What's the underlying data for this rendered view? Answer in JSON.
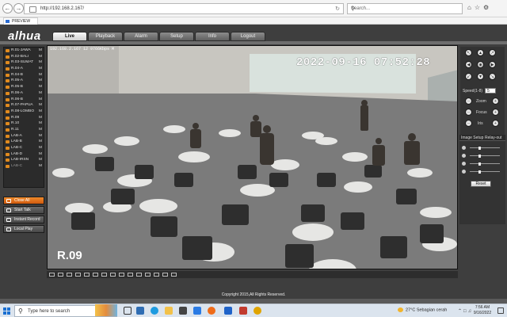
{
  "browser": {
    "url": "http://192.168.2.167/",
    "search_placeholder": "Search...",
    "tab_title": "PREVIEW"
  },
  "app": {
    "logo_text": "alhua",
    "menu": [
      "Live",
      "Playback",
      "Alarm",
      "Setup",
      "Info",
      "Logout"
    ],
    "active_menu": "Live",
    "channels": [
      {
        "label": "R.01-JAWA",
        "flag": "M"
      },
      {
        "label": "R.02-BALI",
        "flag": "M"
      },
      {
        "label": "R.03-SUMAT",
        "flag": "M"
      },
      {
        "label": "R.04-A",
        "flag": "M"
      },
      {
        "label": "R.04-B",
        "flag": "M"
      },
      {
        "label": "R.05-A",
        "flag": "M"
      },
      {
        "label": "R.05-B",
        "flag": "M"
      },
      {
        "label": "R.06-A",
        "flag": "M"
      },
      {
        "label": "R.06-B",
        "flag": "M"
      },
      {
        "label": "R.07-PAPUA",
        "flag": "M"
      },
      {
        "label": "R.08-LOMBO",
        "flag": "M"
      },
      {
        "label": "R.09",
        "flag": "M"
      },
      {
        "label": "R.10",
        "flag": "M"
      },
      {
        "label": "R.11",
        "flag": "M"
      },
      {
        "label": "LAB-A",
        "flag": "M"
      },
      {
        "label": "LAB-B",
        "flag": "M"
      },
      {
        "label": "LAB-C",
        "flag": "M"
      },
      {
        "label": "LAB-D",
        "flag": "M"
      },
      {
        "label": "LAB-IRSN",
        "flag": "M"
      },
      {
        "label": "LAB-C",
        "flag": "M"
      }
    ],
    "buttons": {
      "close_all": "Close All",
      "start_talk": "Start Talk",
      "instant_record": "Instant Record",
      "local_play": "Local Play"
    },
    "video": {
      "info": "192.168.2.167 12 9766Kbps M",
      "timestamp": "2022-09-16 07:52:28",
      "camera_name": "R.09"
    },
    "ptz": {
      "speed_label": "Speed(1-8)",
      "speed_value": "5",
      "zoom_label": "Zoom",
      "focus_label": "Focus",
      "iris_label": "Iris"
    },
    "image_setup": {
      "tab_image": "Image Setup",
      "tab_relay": "Relay-out",
      "reset_label": "Reset",
      "sliders": [
        0.3,
        0.3,
        0.3,
        0.3
      ]
    },
    "footer": "Copyright 2015,All Rights Reserved."
  },
  "taskbar": {
    "search_placeholder": "Type here to search",
    "weather": "27°C  Sebagian cerah",
    "time": "7:56 AM",
    "date": "9/16/2022"
  }
}
